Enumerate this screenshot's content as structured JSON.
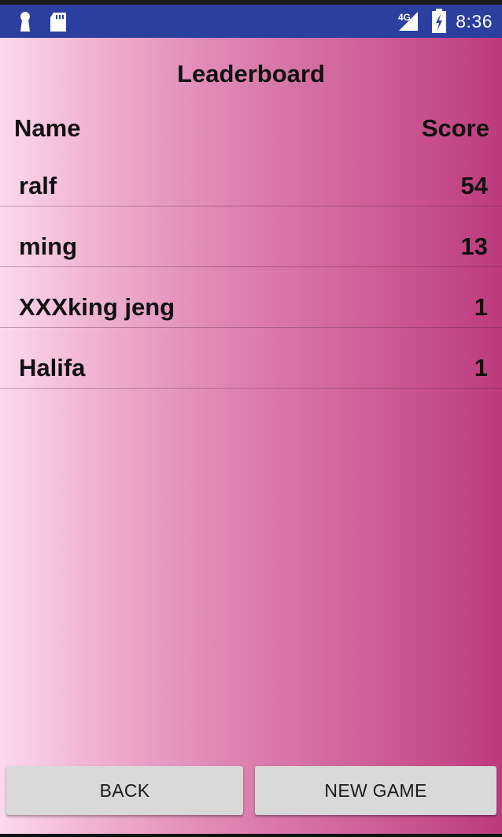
{
  "status_bar": {
    "time": "8:36",
    "network": "4G",
    "icons": [
      "keyhole-icon",
      "sd-card-icon",
      "signal-icon",
      "battery-charging-icon"
    ],
    "color": "#2b3f9e"
  },
  "leaderboard": {
    "title": "Leaderboard",
    "header": {
      "name": "Name",
      "score": "Score"
    },
    "rows": [
      {
        "name": "ralf",
        "score": "54"
      },
      {
        "name": "ming",
        "score": "13"
      },
      {
        "name": "XXXking jeng",
        "score": "1"
      },
      {
        "name": "Halifa",
        "score": "1"
      }
    ]
  },
  "buttons": {
    "back": "BACK",
    "new_game": "NEW GAME"
  },
  "colors": {
    "gradient_start": "#fcd9ec",
    "gradient_end": "#bd3a7d",
    "button_bg": "#d9d9d9"
  }
}
